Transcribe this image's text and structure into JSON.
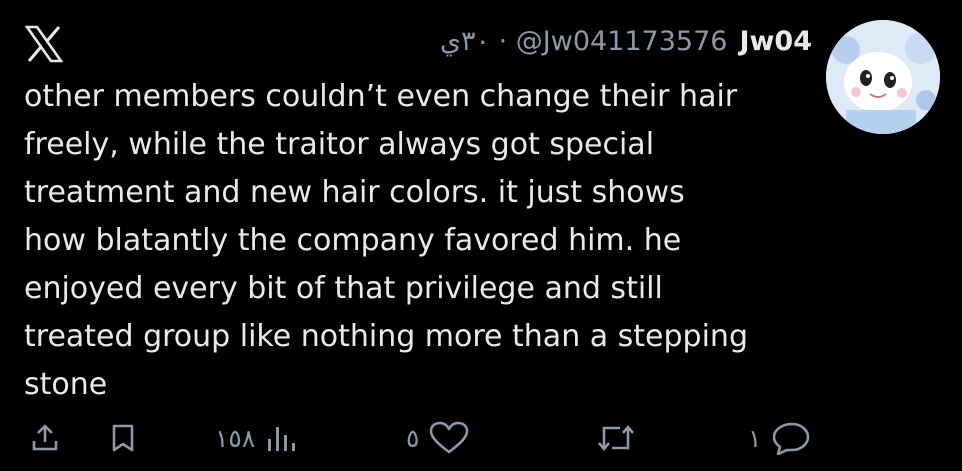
{
  "header": {
    "brand_icon": "x-logo-icon",
    "display_name": "Jw04",
    "handle_time": "٣٠ي · @Jw041173576"
  },
  "tweet": {
    "text": "other members couldn’t even change their hair\nfreely, while the traitor always got special\ntreatment and new hair colors. it just shows\nhow blatantly the company favored him. he\nenjoyed every bit of that privilege and still\ntreated group like nothing more than a stepping\nstone"
  },
  "actions": {
    "views_count": "١٥٨",
    "likes_count": "٥",
    "reposts_count": "",
    "replies_count": "١",
    "icons": [
      "share-icon",
      "bookmark-icon",
      "views-icon",
      "like-icon",
      "repost-icon",
      "reply-icon"
    ]
  },
  "colors": {
    "background": "#000000",
    "text": "#e7e9ea",
    "secondary": "#8b98a5"
  }
}
